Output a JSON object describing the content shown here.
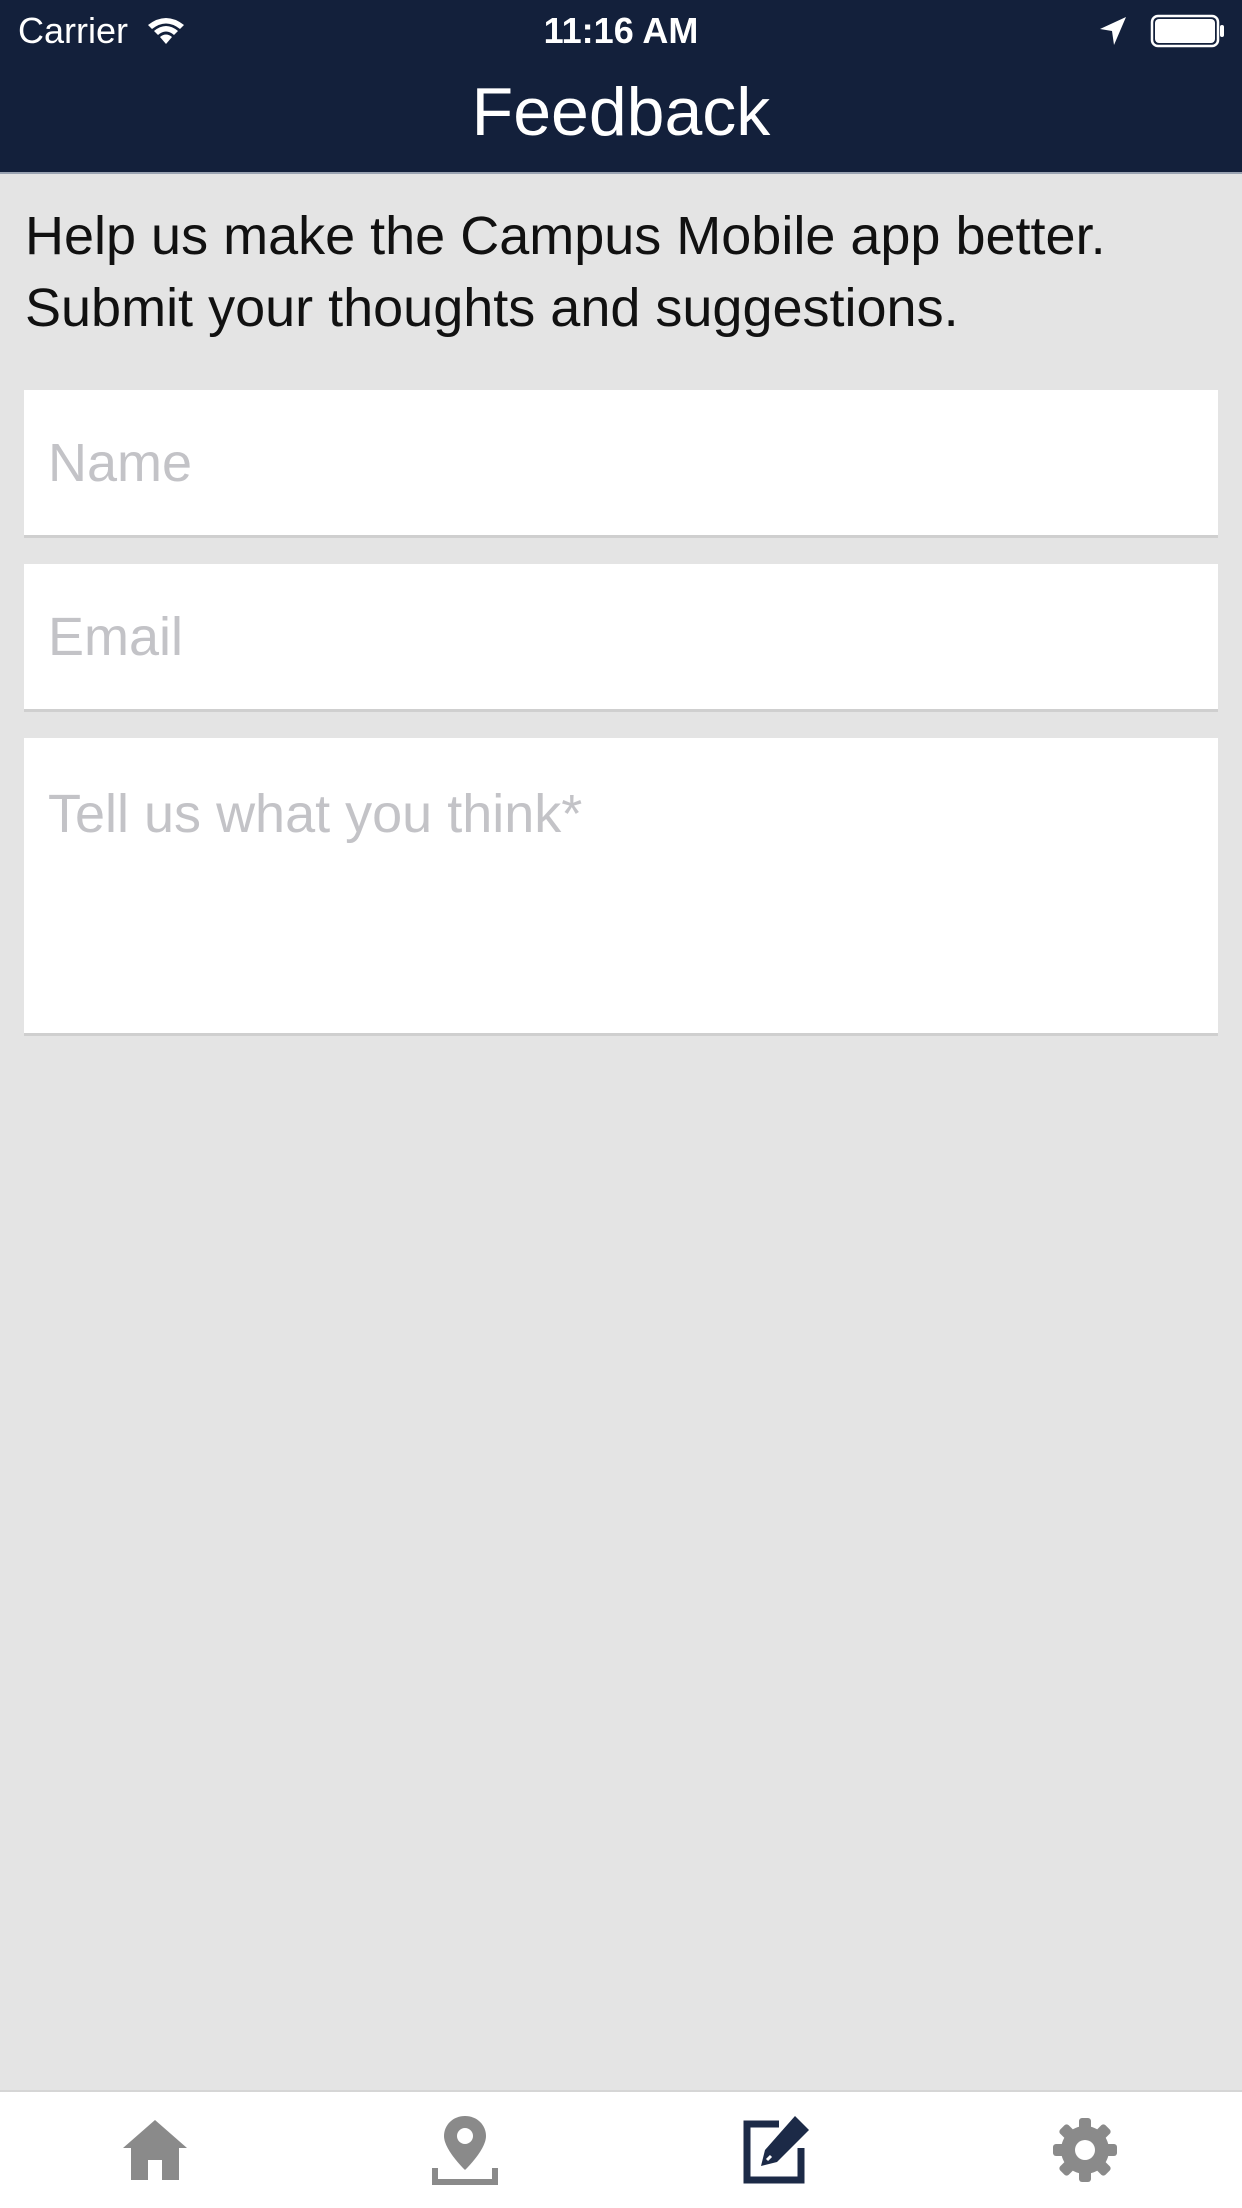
{
  "status_bar": {
    "carrier": "Carrier",
    "time": "11:16 AM",
    "wifi_icon": "wifi-icon",
    "location_icon": "location-arrow-icon",
    "battery_icon": "battery-icon"
  },
  "header": {
    "title": "Feedback",
    "background": "#13203b"
  },
  "intro": {
    "text": "Help us make the Campus Mobile app better. Submit your thoughts and suggestions."
  },
  "form": {
    "name": {
      "value": "",
      "placeholder": "Name"
    },
    "email": {
      "value": "",
      "placeholder": "Email"
    },
    "comments": {
      "value": "",
      "placeholder": "Tell us what you think*"
    }
  },
  "tab_bar": {
    "tabs": [
      {
        "icon": "home-icon",
        "active": false
      },
      {
        "icon": "map-pin-icon",
        "active": false
      },
      {
        "icon": "edit-icon",
        "active": true
      },
      {
        "icon": "gear-icon",
        "active": false
      }
    ],
    "active_color": "#1c2a47",
    "inactive_color": "#8a8a8a"
  }
}
